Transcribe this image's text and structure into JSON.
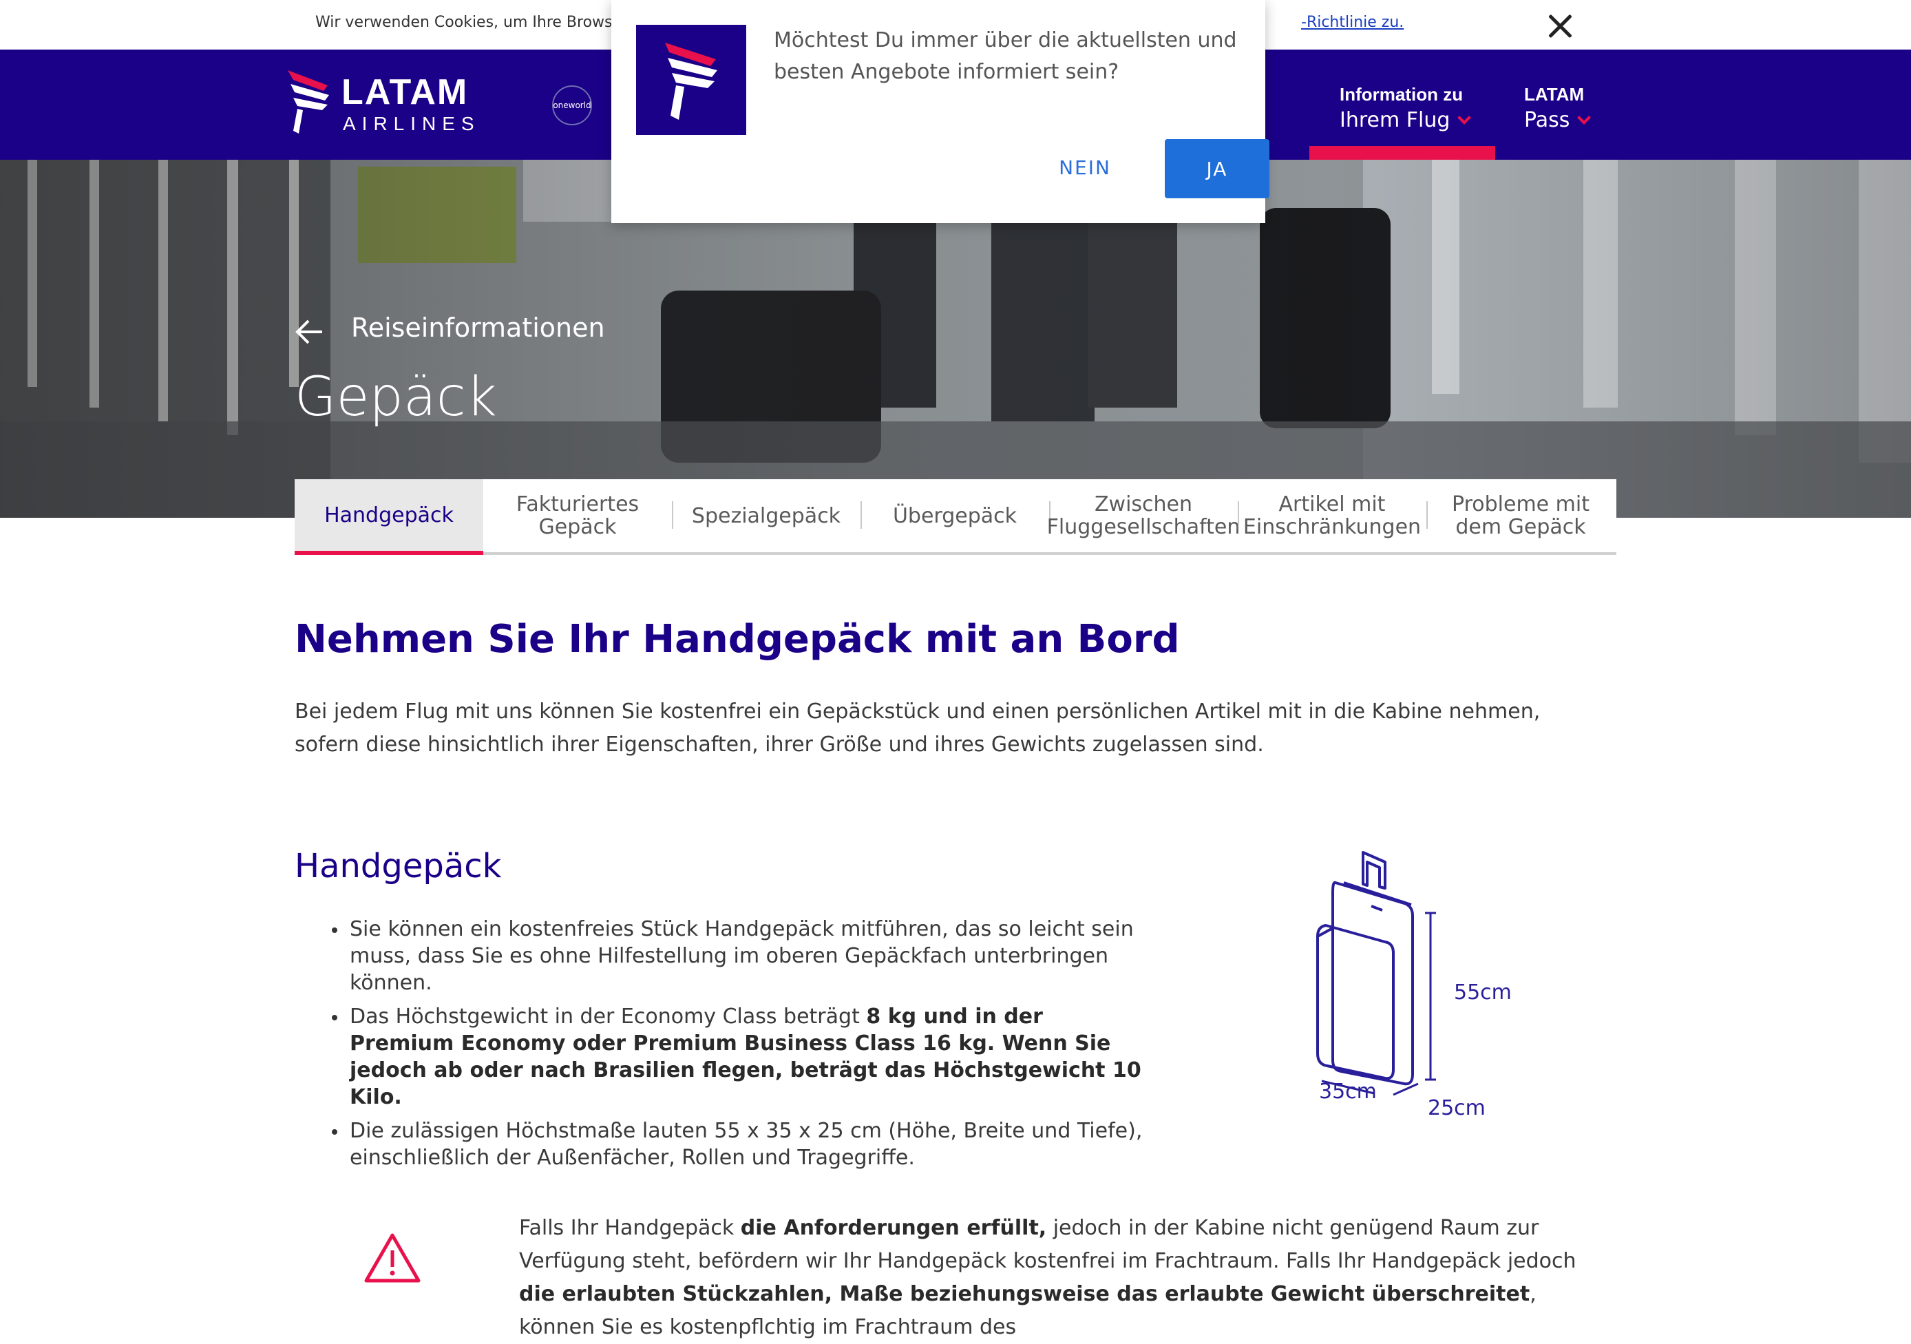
{
  "cookie": {
    "text": "Wir verwenden Cookies, um Ihre Browser-",
    "link": "-Richtlinie zu.",
    "close_icon": "close-icon"
  },
  "header": {
    "logo_line1": "LATAM",
    "logo_line2": "AIRLINES",
    "oneworld": "oneworld",
    "nav": [
      {
        "top": "Information zu",
        "bottom": "Ihrem Flug"
      },
      {
        "top": "LATAM",
        "bottom": "Pass"
      }
    ],
    "colors": {
      "brand": "#1b0088",
      "accent": "#e8114b"
    }
  },
  "hero": {
    "breadcrumb": "Reiseinformationen",
    "title": "Gepäck"
  },
  "tabs": [
    {
      "label": "Handgepäck"
    },
    {
      "label": "Fakturiertes Gepäck"
    },
    {
      "label": "Spezialgepäck"
    },
    {
      "label": "Übergepäck"
    },
    {
      "label": "Zwischen Fluggesellschaften"
    },
    {
      "label": "Artikel mit Einschränkungen"
    },
    {
      "label": "Probleme mit dem Gepäck"
    }
  ],
  "content": {
    "heading": "Nehmen Sie Ihr Handgepäck mit an Bord",
    "intro": "Bei jedem Flug mit uns können Sie kostenfrei ein Gepäckstück und einen persönlichen Artikel mit in die Kabine nehmen, sofern diese hinsichtlich ihrer Eigenschaften, ihrer Größe und ihres Gewichts zugelassen sind.",
    "subheading": "Handgepäck",
    "rule1": "Sie können ein kostenfreies Stück Handgepäck mitführen, das so leicht sein muss, dass Sie es ohne Hilfestellung im oberen Gepäckfach unterbringen können.",
    "rule2_plain": "Das Höchstgewicht in der Economy Class beträgt ",
    "rule2_bold": "8 kg und in der Premium Economy oder Premium Business Class 16 kg. Wenn Sie jedoch ab oder nach Brasilien flegen, beträgt das Höchstgewicht 10 Kilo.",
    "rule3": "Die zulässigen Höchstmaße lauten 55 x 35 x 25 cm (Höhe, Breite und Tiefe), einschließlich der Außenfächer, Rollen und Tragegriffe.",
    "dim_height": "55cm",
    "dim_width": "35cm",
    "dim_depth": "25cm",
    "warn_1": "Falls Ihr Handgepäck ",
    "warn_2": "die Anforderungen erfüllt,",
    "warn_3": " jedoch in der Kabine nicht genügend Raum zur Verfügung steht, befördern wir Ihr Handgepäck kostenfrei im Frachtraum. Falls Ihr Handgepäck jedoch ",
    "warn_4": "die erlaubten Stückzahlen, Maße beziehungsweise das erlaubte Gewicht überschreitet",
    "warn_5": ", können Sie es kostenpflchtig im Frachtraum des"
  },
  "modal": {
    "text": "Möchtest Du immer über die aktuellsten und besten Angebote informiert sein?",
    "no": "NEIN",
    "yes": "JA"
  }
}
